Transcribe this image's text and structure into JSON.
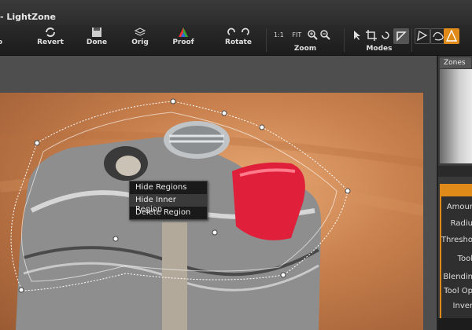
{
  "window": {
    "title": "- LightZone"
  },
  "toolbar": {
    "first_label": "o",
    "revert": "Revert",
    "done": "Done",
    "orig": "Orig",
    "proof": "Proof",
    "rotate": "Rotate",
    "zoom": "Zoom",
    "zoom_1to1": "1:1",
    "zoom_fit": "FIT",
    "modes": "Modes"
  },
  "panel": {
    "zones_tab": "Zones",
    "props": [
      "Amour",
      "Radiu",
      "Thresho",
      "Tool",
      "Blendin",
      "Tool Op",
      "Inver"
    ]
  },
  "context_menu": {
    "items": [
      "Hide Regions",
      "Hide Inner Region",
      "Delete Region"
    ],
    "highlighted": "Hide Inner Region"
  },
  "colors": {
    "accent": "#e08a1a",
    "region_outline": "#ffffff",
    "lighter_cap": "#e0203a"
  }
}
